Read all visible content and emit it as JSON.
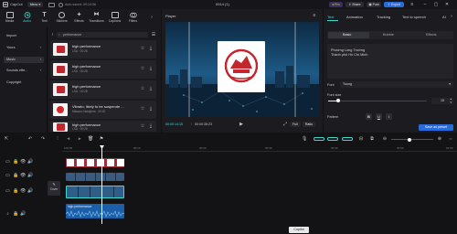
{
  "titlebar": {
    "app_name": "CapCut",
    "menu_label": "Menu",
    "autosave": "Auto saved: 09:24:56",
    "project_name": "0914 (1)",
    "pro_label": "Pro",
    "share_label": "Share",
    "post_label": "Post",
    "export_label": "Export"
  },
  "toolbar": {
    "items": [
      {
        "label": "Media",
        "icon": "media-icon"
      },
      {
        "label": "Audio",
        "icon": "audio-icon"
      },
      {
        "label": "Text",
        "icon": "text-icon"
      },
      {
        "label": "Stickers",
        "icon": "stickers-icon"
      },
      {
        "label": "Effects",
        "icon": "effects-icon"
      },
      {
        "label": "Transitions",
        "icon": "transitions-icon"
      },
      {
        "label": "Captions",
        "icon": "captions-icon"
      },
      {
        "label": "Filters",
        "icon": "filters-icon"
      }
    ],
    "active_index": 1
  },
  "leftnav": {
    "items": [
      "Import",
      "Yours",
      "Music",
      "Sounds effe...",
      "Copyright"
    ],
    "selected_index": 2
  },
  "medialist": {
    "search_placeholder": "performance",
    "items": [
      {
        "title": "high performance",
        "meta": "LSA · 00:28"
      },
      {
        "title": "high performance",
        "meta": "LSA · 00:28"
      },
      {
        "title": "high performance",
        "meta": "LSA · 00:28"
      },
      {
        "title": "Vibrato, likely to be suspende ...",
        "meta": "Masaoo Nakajima · 00:20"
      },
      {
        "title": "high performance",
        "meta": "LSA · 00:28"
      }
    ]
  },
  "player": {
    "title": "Player",
    "time_current": "00:00:14:15",
    "time_total": "00:00:35:23",
    "full_label": "Full",
    "ratio_label": "Ratio"
  },
  "rightpanel": {
    "tabs": [
      "Text",
      "Animation",
      "Tracking",
      "Text to speech",
      "AI"
    ],
    "active_tab": 0,
    "subtabs": [
      "Basic",
      "Bubble",
      "Effects"
    ],
    "active_subtab": 0,
    "text_line1": "Phường Long Trường",
    "text_line2": "Thành phố Hồ Chí Minh",
    "font_label": "Font",
    "font_value": "Tuong",
    "fontsize_label": "Font size",
    "fontsize_value": "15",
    "fontsize_level": 0.1,
    "pattern_label": "Pattern",
    "pattern_buttons": [
      "B",
      "U",
      "I"
    ],
    "save_preset": "Save as preset"
  },
  "timeline": {
    "ruler": [
      "100:00",
      "00:10",
      "00:20",
      "00:30",
      "00:40",
      "00:50",
      "01:00"
    ],
    "cover_label": "Cover",
    "audio_clip": "high performance",
    "copilot": "Copilot",
    "colors": {
      "accent": "#3fd9d0",
      "audio_clip": "#1b5fa8",
      "video_clip": "#2b3a55",
      "sticker_clip": "#a02e3a"
    }
  }
}
